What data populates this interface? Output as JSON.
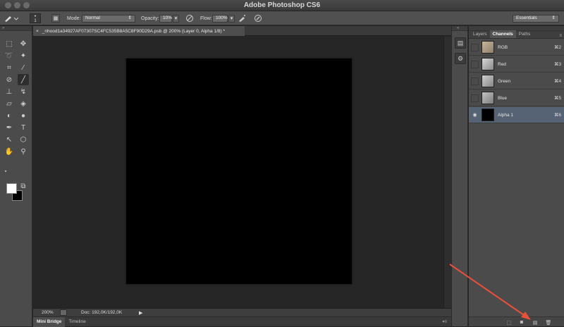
{
  "app": {
    "title": "Adobe Photoshop CS6"
  },
  "options_bar": {
    "brush_size": "1",
    "mode_label": "Mode:",
    "mode_value": "Normal",
    "opacity_label": "Opacity:",
    "opacity_value": "10%",
    "flow_label": "Flow:",
    "flow_value": "100%",
    "workspace": "Essentials"
  },
  "document": {
    "tab_title": "_nhood1a34927AF07307SC4FC535B8A5C8F90D29A.psb @ 200% (Layer 0, Alpha 1/8) *",
    "close_glyph": "×"
  },
  "status": {
    "zoom": "200%",
    "doc_info": "Doc: 192,0K/192,0K"
  },
  "bottom_tabs": [
    "Mini Bridge",
    "Timeline"
  ],
  "panel": {
    "tabs": [
      "Layers",
      "Channels",
      "Paths"
    ],
    "active_tab": "Channels",
    "channels": [
      {
        "name": "RGB",
        "shortcut": "⌘2",
        "visible": false,
        "selected": false
      },
      {
        "name": "Red",
        "shortcut": "⌘3",
        "visible": false,
        "selected": false
      },
      {
        "name": "Green",
        "shortcut": "⌘4",
        "visible": false,
        "selected": false
      },
      {
        "name": "Blue",
        "shortcut": "⌘5",
        "visible": false,
        "selected": false
      },
      {
        "name": "Alpha 1",
        "shortcut": "⌘6",
        "visible": true,
        "selected": true
      }
    ]
  },
  "colors": {
    "annotation_arrow": "#e8503a",
    "selected_row": "#556374",
    "canvas": "#000000"
  }
}
